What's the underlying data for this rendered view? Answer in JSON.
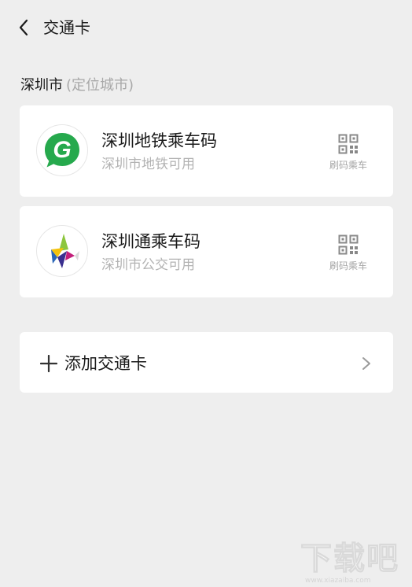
{
  "navbar": {
    "title": "交通卡"
  },
  "section": {
    "city": "深圳市",
    "hint": "(定位城市)"
  },
  "cards": [
    {
      "title": "深圳地铁乘车码",
      "subtitle": "深圳市地铁可用",
      "action_label": "刷码乘车",
      "logo_icon": "shenzhen-metro-logo",
      "accent": "#26a94d"
    },
    {
      "title": "深圳通乘车码",
      "subtitle": "深圳市公交可用",
      "action_label": "刷码乘车",
      "logo_icon": "shenzhen-tong-logo",
      "accent": "#3a2f8f"
    }
  ],
  "add_card": {
    "label": "添加交通卡"
  },
  "watermark": {
    "text": "下载吧",
    "url": "www.xiazaiba.com"
  },
  "colors": {
    "background": "#eeeeee",
    "card": "#ffffff",
    "secondary_text": "#b3b3b3"
  }
}
